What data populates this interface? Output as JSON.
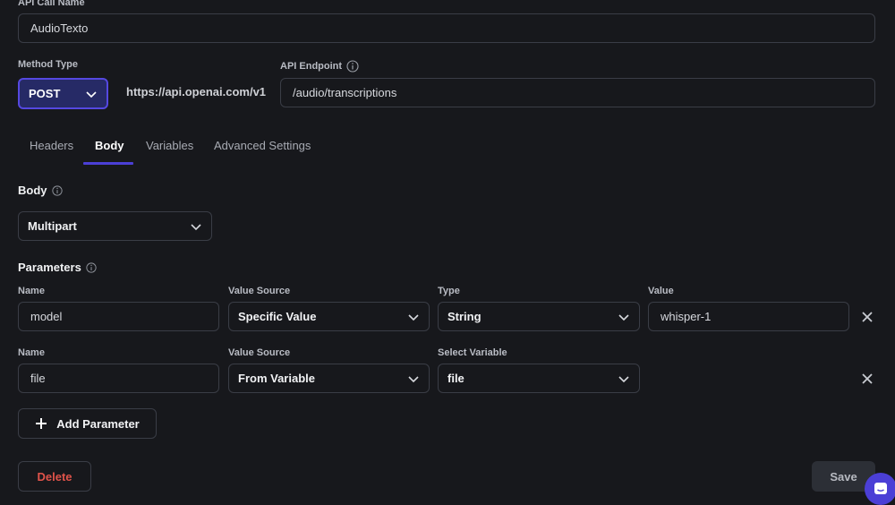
{
  "api_call_name": {
    "label": "API Call Name",
    "value": "AudioTexto"
  },
  "method_type": {
    "label": "Method Type",
    "value": "POST"
  },
  "base_url": "https://api.openai.com/v1",
  "api_endpoint": {
    "label": "API Endpoint",
    "value": "/audio/transcriptions"
  },
  "tabs": [
    {
      "label": "Headers"
    },
    {
      "label": "Body"
    },
    {
      "label": "Variables"
    },
    {
      "label": "Advanced Settings"
    }
  ],
  "body_section": {
    "title": "Body",
    "type_value": "Multipart"
  },
  "parameters_section": {
    "title": "Parameters"
  },
  "parameters": [
    {
      "name_label": "Name",
      "name_value": "model",
      "source_label": "Value Source",
      "source_value": "Specific Value",
      "type_label": "Type",
      "type_value": "String",
      "value_label": "Value",
      "value_value": "whisper-1"
    },
    {
      "name_label": "Name",
      "name_value": "file",
      "source_label": "Value Source",
      "source_value": "From Variable",
      "variable_label": "Select Variable",
      "variable_value": "file"
    }
  ],
  "add_parameter_label": "Add Parameter",
  "delete_label": "Delete",
  "save_label": "Save",
  "colors": {
    "accent": "#4b3fd6",
    "danger": "#e0534a",
    "background": "#17181c"
  }
}
